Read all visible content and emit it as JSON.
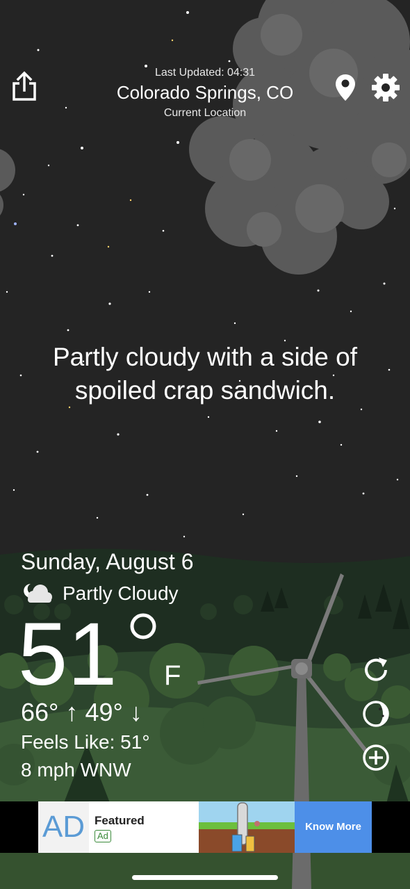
{
  "header": {
    "last_updated": "Last Updated: 04:31",
    "location_name": "Colorado Springs, CO",
    "location_subtitle": "Current Location"
  },
  "forecast_quote": {
    "line1": "Partly cloudy with a side of",
    "line2": "spoiled crap sandwich."
  },
  "weather": {
    "date": "Sunday, August 6",
    "condition": "Partly Cloudy",
    "condition_icon": "moon-cloud-icon",
    "temperature": "51",
    "unit": "F",
    "hi_lo": "66° ↑  49° ↓",
    "feels_like": "Feels Like: 51°",
    "wind": "8 mph WNW"
  },
  "actions": {
    "share_icon": "share-icon",
    "location_icon": "location-pin-icon",
    "settings_icon": "gear-icon",
    "refresh_icon": "refresh-icon",
    "moon_icon": "moon-phase-icon",
    "add_icon": "add-icon"
  },
  "ad": {
    "logo_text": "AD",
    "title": "Featured",
    "badge": "Ad",
    "cta": "Know More"
  },
  "colors": {
    "sky": "#242424",
    "hills_dark": "#1f3322",
    "hills_mid": "#2f4a2f",
    "cloud": "#5a5a5a",
    "ad_cta": "#4d8fe8"
  }
}
